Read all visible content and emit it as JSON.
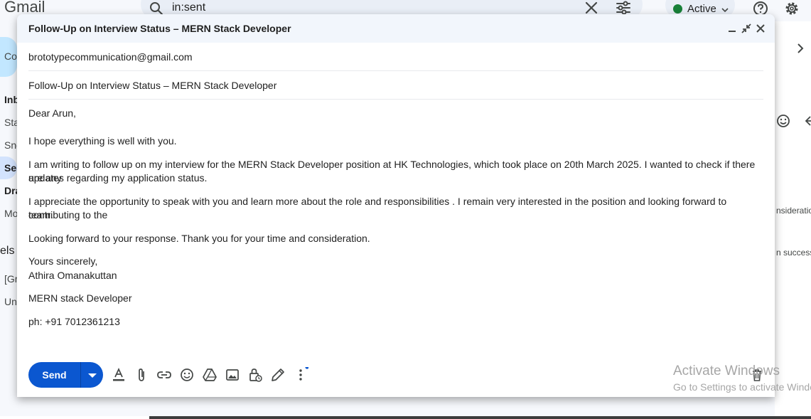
{
  "gmail": {
    "logo_text": "Gmail",
    "search_query": "in:sent",
    "status_label": "Active",
    "sidebar_fragments": [
      "Co",
      "Inb",
      "Sta",
      "Sno",
      "Se",
      "Dra",
      "Mo",
      "els",
      "[Gr",
      "Un"
    ],
    "right_fragments": [
      "nsideratio",
      "n success"
    ]
  },
  "compose": {
    "title": "Follow-Up on Interview Status – MERN Stack Developer",
    "to": "brototypecommunication@gmail.com",
    "subject": "Follow-Up on Interview Status – MERN Stack Developer",
    "body": {
      "greeting": "Dear Arun,",
      "p1": "I hope everything is well with you.",
      "p2_line1": "I am writing to follow up on my interview for the MERN Stack Developer position at HK Technologies, which took place on 20th March 2025. I wanted to check if there are any",
      "p2_line2": "updates regarding my application status.",
      "p3_line1": "I appreciate the opportunity to speak with you and learn more about the role and responsibilities . I remain very interested in the position and looking forward  to contributing to the",
      "p3_line2": "team.",
      "p4": "Looking forward to your response. Thank you for your time and consideration.",
      "closing": "Yours sincerely,",
      "name": "Athira Omanakuttan",
      "role": "MERN stack Developer",
      "phone": "ph: +91 7012361213"
    },
    "send_label": "Send"
  },
  "watermark": {
    "line1": "Activate Windows",
    "line2": "Go to Settings to activate Windows."
  },
  "colors": {
    "send": "#0b57d0",
    "header_bg": "#f2f6fc",
    "active_dot": "#188038"
  }
}
